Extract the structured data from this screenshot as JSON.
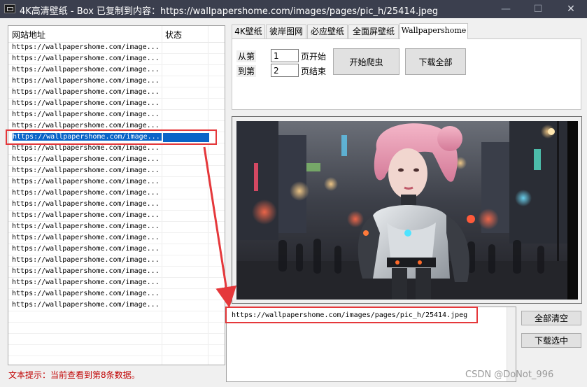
{
  "window": {
    "title": "4K高清壁纸 - Box   已复制到内容：https://wallpapershome.com/images/pages/pic_h/25414.jpeg",
    "minimize": "—",
    "maximize": "☐",
    "close": "✕"
  },
  "list": {
    "columns": [
      "网站地址",
      "状态"
    ],
    "rows": [
      "https://wallpapershome.com/image...",
      "https://wallpapershome.com/image...",
      "https://wallpapershome.com/image...",
      "https://wallpapershome.com/image...",
      "https://wallpapershome.com/image...",
      "https://wallpapershome.com/image...",
      "https://wallpapershome.com/image...",
      "https://wallpapershome.com/image...",
      "https://wallpapershome.com/image...",
      "https://wallpapershome.com/image...",
      "https://wallpapershome.com/image...",
      "https://wallpapershome.com/image...",
      "https://wallpapershome.com/image...",
      "https://wallpapershome.com/image...",
      "https://wallpapershome.com/image...",
      "https://wallpapershome.com/image...",
      "https://wallpapershome.com/image...",
      "https://wallpapershome.com/image...",
      "https://wallpapershome.com/image...",
      "https://wallpapershome.com/image...",
      "https://wallpapershome.com/image...",
      "https://wallpapershome.com/image...",
      "https://wallpapershome.com/image...",
      "https://wallpapershome.com/image..."
    ],
    "selected_index": 8
  },
  "status_hint": "文本提示：当前查看到第8条数据。",
  "tabs": [
    {
      "label": "4K壁纸",
      "active": false
    },
    {
      "label": "彼岸图网",
      "active": false
    },
    {
      "label": "必应壁纸",
      "active": false
    },
    {
      "label": "全面屏壁纸",
      "active": false
    },
    {
      "label": "Wallpapershome",
      "active": true
    }
  ],
  "crawl": {
    "from_label": "从第",
    "to_label": "到第",
    "from_value": "1",
    "to_value": "2",
    "start_suffix": "页开始",
    "end_suffix": "页结束",
    "start_button": "开始爬虫",
    "download_all_button": "下载全部"
  },
  "url_box": {
    "text": "https://wallpapershome.com/images/pages/pic_h/25414.jpeg"
  },
  "actions": {
    "clear_all": "全部清空",
    "download_selected": "下载选中"
  },
  "watermark": "CSDN @DoNot_996",
  "colors": {
    "titlebar": "#3b3f4e",
    "selection": "#0a64c8",
    "annotation_red": "#e5383b",
    "hint_red": "#c00000"
  }
}
